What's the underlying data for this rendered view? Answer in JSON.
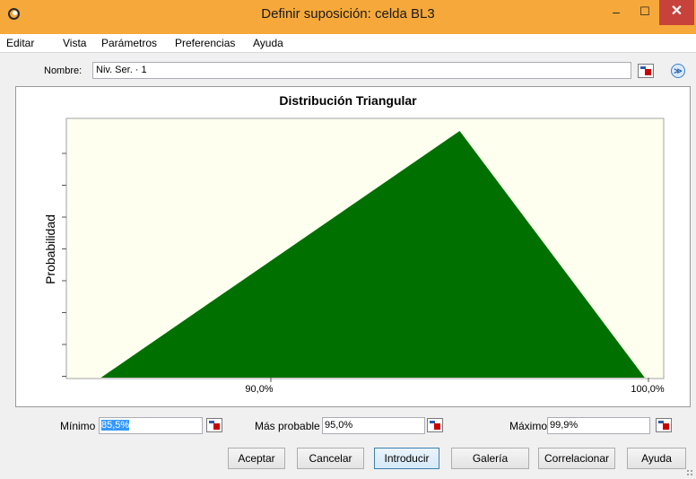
{
  "window": {
    "title": "Definir suposición: celda BL3",
    "minimize_glyph": "–",
    "maximize_glyph": "☐",
    "close_glyph": "✕",
    "title_bar_color": "#f6a93a"
  },
  "menu": [
    "Editar",
    "Vista",
    "Parámetros",
    "Preferencias",
    "Ayuda"
  ],
  "name_row": {
    "label": "Nombre:",
    "value": "Niv. Ser. · 1",
    "expand_glyph": "≫"
  },
  "chart_data": {
    "type": "area",
    "title": "Distribución Triangular",
    "ylabel": "Probabilidad",
    "x_ticks": [
      "90,0%",
      "100,0%"
    ],
    "min": 85.5,
    "mode": 95.0,
    "max": 99.9,
    "fill_color": "#007000",
    "plot_background": "#fffff0"
  },
  "params": {
    "min_label": "Mínimo",
    "min_value": "85,5%",
    "mode_label": "Más probable",
    "mode_value": "95,0%",
    "max_label": "Máximo",
    "max_value": "99,9%"
  },
  "buttons": {
    "accept": "Aceptar",
    "cancel": "Cancelar",
    "enter": "Introducir",
    "gallery": "Galería",
    "correlate": "Correlacionar",
    "help": "Ayuda"
  }
}
